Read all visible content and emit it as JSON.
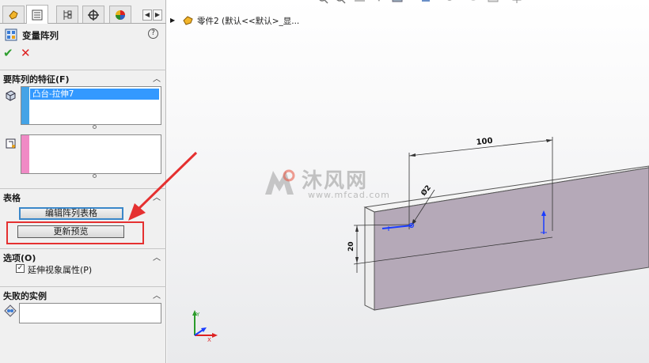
{
  "property_manager": {
    "title": "变量阵列",
    "help_label": "?",
    "ok_icon": "checkmark-icon",
    "cancel_icon": "x-icon",
    "tabs": [
      {
        "icon": "feature-manager-icon"
      },
      {
        "icon": "property-manager-icon"
      },
      {
        "icon": "configuration-manager-icon"
      },
      {
        "icon": "dimxpert-icon"
      },
      {
        "icon": "display-manager-icon"
      }
    ],
    "sections": {
      "features_to_pattern": {
        "label": "要阵列的特征(F)",
        "selected_item": "凸台-拉伸7",
        "strip_color": "#44a3e6"
      },
      "reference_box": {
        "strip_color": "#f08ac5"
      },
      "table": {
        "label": "表格",
        "edit_button": "编辑阵列表格",
        "refresh_button": "更新预览"
      },
      "options": {
        "label": "选项(O)",
        "checkbox_label": "延伸视象属性(P)",
        "checkbox_checked": true
      },
      "instances_failed": {
        "label": "失败的实例"
      }
    }
  },
  "graphics": {
    "tree_label": "零件2 (默认<<默认>_显...",
    "dimensions": {
      "length": "100",
      "height": "20",
      "diameter": "Ø2"
    },
    "watermark": {
      "cn": "沐风网",
      "en": "www.mfcad.com"
    }
  },
  "colors": {
    "highlight_frame": "#e53030",
    "arrow": "#e53030",
    "part_face": "#b5a9b8",
    "selection_blue": "#3399ff"
  }
}
